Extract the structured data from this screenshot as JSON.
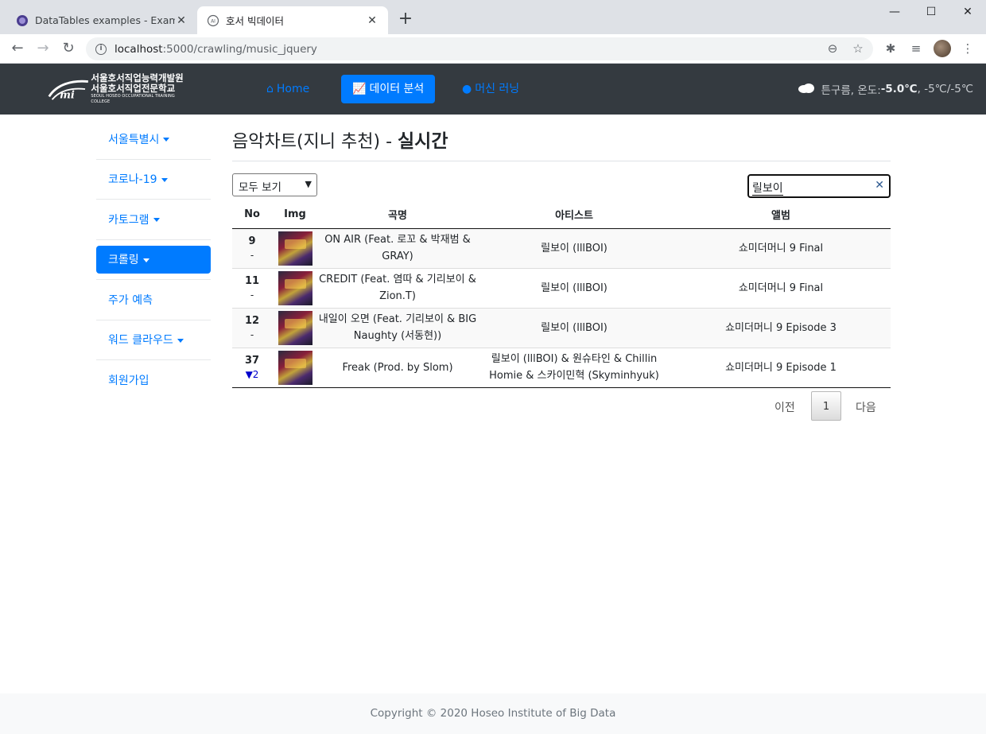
{
  "browser": {
    "tabs": [
      {
        "title": "DataTables examples - Example",
        "active": false
      },
      {
        "title": "호서 빅데이터",
        "active": true
      }
    ],
    "new_tab_icon": "plus-icon",
    "window_controls": [
      "minimize",
      "maximize",
      "close"
    ],
    "url_host": "localhost",
    "url_path": ":5000/crawling/music_jquery"
  },
  "site": {
    "logo_line1": "서울호서직업능력개발원",
    "logo_line2": "서울호서직업전문학교",
    "logo_line3": "SEOUL HOSEO OCCUPATIONAL TRAINING COLLEGE",
    "nav": [
      {
        "label": "Home",
        "icon": "home-icon",
        "active": false
      },
      {
        "label": "데이터 분석",
        "icon": "chart-icon",
        "active": true
      },
      {
        "label": "머신 러닝",
        "icon": "brain-icon",
        "active": false
      }
    ],
    "weather": {
      "desc": "튼구름, 온도: ",
      "temp": "-5.0℃",
      "range": ", -5℃/-5℃"
    }
  },
  "sidebar": {
    "items": [
      {
        "label": "서울특별시",
        "dropdown": true,
        "active": false
      },
      {
        "label": "코로나-19",
        "dropdown": true,
        "active": false
      },
      {
        "label": "카토그램",
        "dropdown": true,
        "active": false
      },
      {
        "label": "크롤링",
        "dropdown": true,
        "active": true
      },
      {
        "label": "주가 예측",
        "dropdown": false,
        "active": false
      },
      {
        "label": "워드 클라우드",
        "dropdown": true,
        "active": false
      },
      {
        "label": "회원가입",
        "dropdown": false,
        "active": false
      }
    ]
  },
  "main": {
    "title_prefix": "음악차트(지니 추천) - ",
    "title_strong": "실시간",
    "length_select": "모두 보기",
    "search_value": "릴보이",
    "columns": [
      "No",
      "Img",
      "곡명",
      "아티스트",
      "앨범"
    ],
    "rows": [
      {
        "rank": "9",
        "change": "-",
        "change_dir": "same",
        "title": "ON AIR (Feat. 로꼬 & 박재범 & GRAY)",
        "artist": "릴보이 (lllBOI)",
        "album": "쇼미더머니 9 Final"
      },
      {
        "rank": "11",
        "change": "-",
        "change_dir": "same",
        "title": "CREDIT (Feat. 염따 & 기리보이 & Zion.T)",
        "artist": "릴보이 (lllBOI)",
        "album": "쇼미더머니 9 Final"
      },
      {
        "rank": "12",
        "change": "-",
        "change_dir": "same",
        "title": "내일이 오면 (Feat. 기리보이 & BIG Naughty (서동현))",
        "artist": "릴보이 (lllBOI)",
        "album": "쇼미더머니 9 Episode 3"
      },
      {
        "rank": "37",
        "change": "▼2",
        "change_dir": "down",
        "title": "Freak (Prod. by Slom)",
        "artist": "릴보이 (lllBOI) & 원슈타인 & Chillin Homie & 스카이민혁 (Skyminhyuk)",
        "album": "쇼미더머니 9 Episode 1"
      }
    ],
    "pager": {
      "prev": "이전",
      "page": "1",
      "next": "다음"
    }
  },
  "footer": {
    "text": "Copyright © 2020 Hoseo Institute of Big Data"
  }
}
